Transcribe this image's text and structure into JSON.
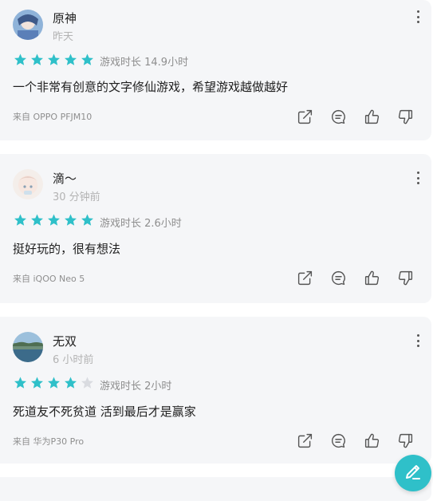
{
  "colors": {
    "accent": "#2fc0c9",
    "star_filled": "#2fc0c9",
    "star_empty": "#d9dbe0"
  },
  "reviews": [
    {
      "username": "原神",
      "time": "昨天",
      "rating": 5,
      "playtime": "游戏时长 14.9小时",
      "content": "一个非常有创意的文字修仙游戏，希望游戏越做越好",
      "device": "来自 OPPO PFJM10"
    },
    {
      "username": "滴～",
      "time": "30 分钟前",
      "rating": 5,
      "playtime": "游戏时长 2.6小时",
      "content": "挺好玩的，很有想法",
      "device": "来自 iQOO Neo 5"
    },
    {
      "username": "无双",
      "time": "6 小时前",
      "rating": 4,
      "playtime": "游戏时长 2小时",
      "content": "死道友不死贫道 活到最后才是赢家",
      "device": "来自 华为P30 Pro"
    }
  ],
  "icons": {
    "more": "more-vertical-icon",
    "share": "share-icon",
    "comment": "comment-icon",
    "like": "thumbs-up-icon",
    "dislike": "thumbs-down-icon",
    "write": "pen-icon"
  }
}
